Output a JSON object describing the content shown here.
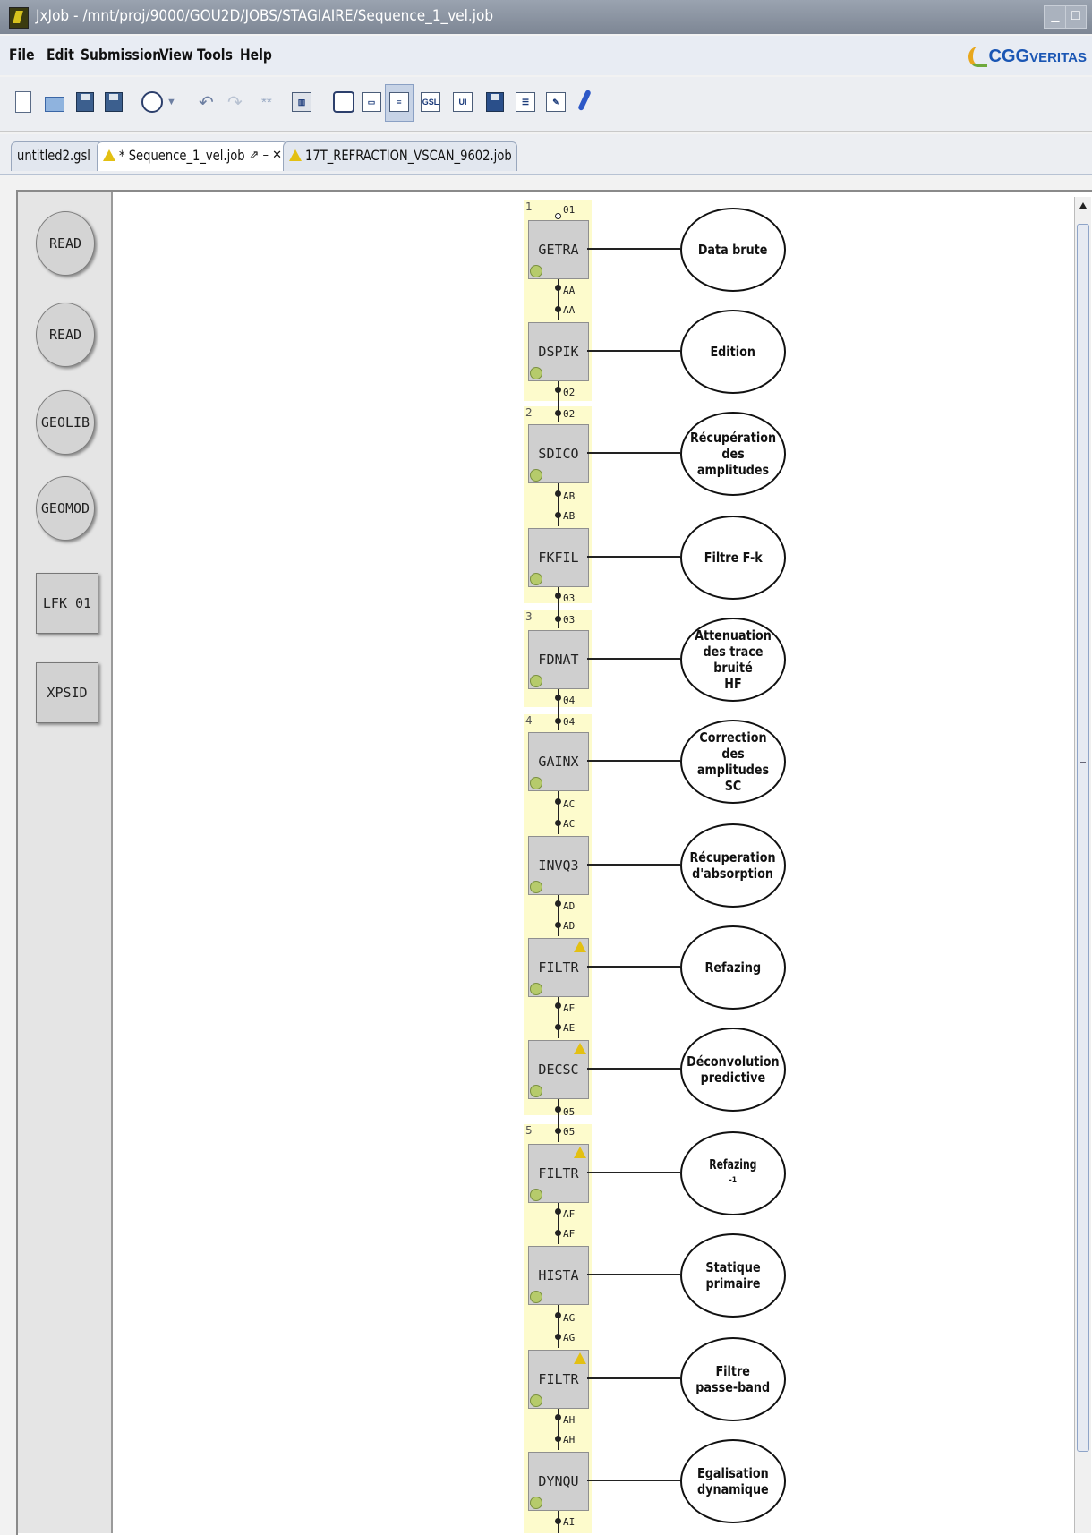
{
  "window": {
    "title": "JxJob - /mnt/proj/9000/GOU2D/JOBS/STAGIAIRE/Sequence_1_vel.job",
    "buttons": [
      "minimize",
      "maximize",
      "close"
    ]
  },
  "menu": {
    "items": [
      "File",
      "Edit",
      "Submission",
      "View",
      "Tools",
      "Help"
    ],
    "logo_main": "CGG",
    "logo_suffix": "VERITAS"
  },
  "toolbar": {
    "icons": [
      "new-file-icon",
      "open-folder-icon",
      "save-icon",
      "save-all-icon",
      "run-icon",
      "dropdown-arrow-icon",
      "undo-icon",
      "redo-icon",
      "asterisk-icon",
      "columns-icon",
      "parameter-icon",
      "monitor-icon",
      "flow-view-icon",
      "gsl-icon",
      "ui-icon",
      "book-icon",
      "list-icon",
      "edit-check-icon",
      "pin-icon"
    ]
  },
  "tabs": [
    {
      "label": "untitled2.gsl",
      "warning": false,
      "active": false
    },
    {
      "label": "* Sequence_1_vel.job",
      "warning": true,
      "active": true,
      "controls": "⇗ – ✕"
    },
    {
      "label": "17T_REFRACTION_VSCAN_9602.job",
      "warning": true,
      "active": false
    }
  ],
  "palette": [
    {
      "label": "READ",
      "shape": "round"
    },
    {
      "label": "READ",
      "shape": "round"
    },
    {
      "label": "GEOLIB",
      "shape": "round"
    },
    {
      "label": "GEOMOD",
      "shape": "round"
    },
    {
      "label": "LFK 01",
      "shape": "rect"
    },
    {
      "label": "XPSID",
      "shape": "rect"
    }
  ],
  "flow": {
    "sequences": [
      "1",
      "2",
      "3",
      "4",
      "5"
    ],
    "first_port": "01",
    "ports": [
      [
        "AA",
        "AA"
      ],
      [
        "02",
        "02"
      ],
      [
        "AB",
        "AB"
      ],
      [
        "03",
        "03"
      ],
      [
        "04",
        "04"
      ],
      [
        "AC",
        "AC"
      ],
      [
        "AD",
        "AD"
      ],
      [
        "AE",
        "AE"
      ],
      [
        "05",
        "05"
      ],
      [
        "AF",
        "AF"
      ],
      [
        "AG",
        "AG"
      ],
      [
        "AH",
        "AH"
      ],
      [
        "AI"
      ]
    ],
    "nodes": [
      {
        "module": "GETRA",
        "comment": "Data brute",
        "warning": false
      },
      {
        "module": "DSPIK",
        "comment": "Edition",
        "warning": false
      },
      {
        "module": "SDICO",
        "comment": "Récupération\ndes amplitudes",
        "warning": false
      },
      {
        "module": "FKFIL",
        "comment": "Filtre F-k",
        "warning": false
      },
      {
        "module": "FDNAT",
        "comment": "Attenuation\ndes trace bruité\nHF",
        "warning": false
      },
      {
        "module": "GAINX",
        "comment": "Correction\ndes amplitudes\nSC",
        "warning": false
      },
      {
        "module": "INVQ3",
        "comment": "Récuperation\nd'absorption",
        "warning": false
      },
      {
        "module": "FILTR",
        "comment": "Refazing",
        "warning": true
      },
      {
        "module": "DECSC",
        "comment": "Déconvolution\npredictive",
        "warning": true
      },
      {
        "module": "FILTR",
        "comment": "Refazing",
        "comment_sup": "-1",
        "warning": true
      },
      {
        "module": "HISTA",
        "comment": "Statique\nprimaire",
        "warning": false
      },
      {
        "module": "FILTR",
        "comment": "Filtre\npasse-band",
        "warning": true
      },
      {
        "module": "DYNQU",
        "comment": "Egalisation\ndynamique",
        "warning": false
      }
    ]
  }
}
